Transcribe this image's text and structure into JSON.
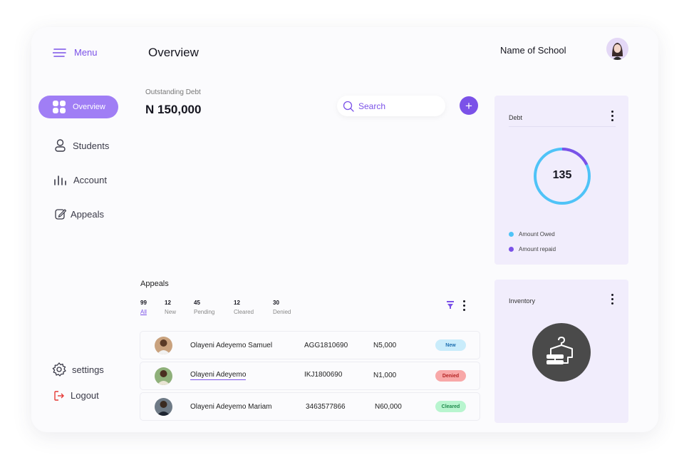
{
  "header": {
    "menu_label": "Menu",
    "page_title": "Overview",
    "school_name": "Name of School"
  },
  "sidebar": {
    "items": [
      {
        "label": "Overview",
        "icon": "grid-icon",
        "active": true
      },
      {
        "label": "Students",
        "icon": "user-icon"
      },
      {
        "label": "Account",
        "icon": "bar-chart-icon"
      },
      {
        "label": "Appeals",
        "icon": "edit-icon"
      }
    ],
    "settings_label": "settings",
    "logout_label": "Logout"
  },
  "summary": {
    "outstanding_label": "Outstanding Debt",
    "outstanding_value": "N 150,000"
  },
  "search": {
    "placeholder": "Search"
  },
  "add_button": {
    "label": "+"
  },
  "debt_card": {
    "title": "Debt",
    "center_value": "135",
    "amount_owed_fraction": 0.82,
    "amount_repaid_fraction": 0.18,
    "legend": [
      {
        "label": "Amount Owed",
        "color": "#4fc3f7"
      },
      {
        "label": "Amount repaid",
        "color": "#7b52e8"
      }
    ]
  },
  "inventory_card": {
    "title": "Inventory"
  },
  "appeals": {
    "title": "Appeals",
    "stats": [
      {
        "count": "99",
        "label": "All"
      },
      {
        "count": "12",
        "label": "New"
      },
      {
        "count": "45",
        "label": "Pending"
      },
      {
        "count": "12",
        "label": "Cleared"
      },
      {
        "count": "30",
        "label": "Denied"
      }
    ],
    "rows": [
      {
        "name": "Olayeni Adeyemo Samuel",
        "code": "AGG1810690",
        "amount": "N5,000",
        "status": "New"
      },
      {
        "name": "Olayeni Adeyemo",
        "code": "IKJ1800690",
        "amount": "N1,000",
        "status": "Denied"
      },
      {
        "name": "Olayeni Adeyemo Mariam",
        "code": "3463577866",
        "amount": "N60,000",
        "status": "Cleared"
      }
    ]
  },
  "colors": {
    "accent": "#7b52e8",
    "accent_light": "#a07ef5",
    "ring": "#4fc3f7",
    "badge_new": "#c9ecfb",
    "badge_denied": "#f8a8a8",
    "badge_cleared": "#b8f5cf"
  }
}
